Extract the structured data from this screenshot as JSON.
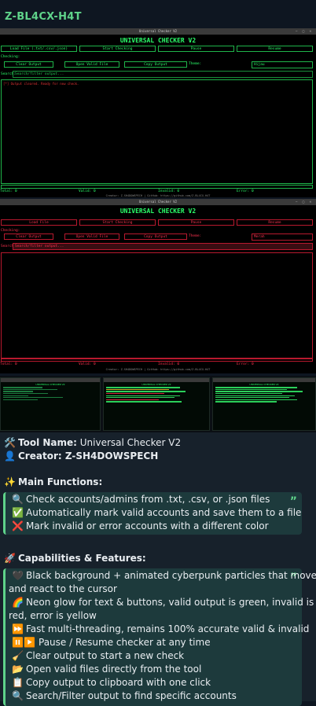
{
  "channel": {
    "title": "Z-BL4CX-H4T"
  },
  "app_green": {
    "window_title": "Universal Checker V2",
    "title": "UNIVERSAL CHECKER V2",
    "buttons": [
      "Load File (.txt/.csv/.json)",
      "Start Checking",
      "Pause",
      "Resume"
    ],
    "checking_label": "Checking:",
    "buttons2": [
      "Clear Output",
      "Open Valid File",
      "Copy Output"
    ],
    "theme_label": "Theme:",
    "theme_value": "Hijau",
    "search_label": "Search:",
    "search_placeholder": "Search/filter output...",
    "output_line": "[*] Output cleared. Ready for new check.",
    "status": [
      "Total: 0",
      "Valid: 0",
      "Invalid: 0",
      "Error: 0"
    ],
    "credit": "Creator: Z-SH4DOWSPECH | GitHub: https://github.com/Z-BL4CX-H4T"
  },
  "app_red": {
    "title": "UNIVERSAL CHECKER V2",
    "buttons": [
      "Load File",
      "Start Checking",
      "Pause",
      "Resume"
    ],
    "checking_label": "Checking:",
    "buttons2": [
      "Clear Output",
      "Open Valid File",
      "Copy Output"
    ],
    "theme_label": "Theme:",
    "theme_value": "Merah",
    "search_label": "Search:",
    "search_placeholder": "Search/filter output...",
    "status": [
      "Total: 0",
      "Valid: 0",
      "Invalid: 0",
      "Error: 0"
    ],
    "credit": "Creator: Z-SH4DOWSPECH | GitHub: https://github.com/Z-BL4CX-H4T"
  },
  "thumbs": {
    "titles": [
      "UNIVERSAL CHECKER V2",
      "UNIVERSAL CHECKER V2",
      "UNIVERSAL CHECKER V2"
    ]
  },
  "post": {
    "tool_label": "Tool Name:",
    "tool_value": " Universal Checker V2",
    "creator_label": "Creator:",
    "creator_value": " Z-SH4DOWSPECH",
    "main_heading": "Main Functions:",
    "main_items": [
      {
        "icon": "🔍",
        "text": "Check accounts/admins from .txt, .csv, or .json files"
      },
      {
        "icon": "✅",
        "text": "Automatically mark valid accounts and save them to a file"
      },
      {
        "icon": "❌",
        "text": "Mark invalid or error accounts with a different color"
      }
    ],
    "cap_heading": "Capabilities & Features:",
    "cap_items": [
      {
        "icon": "🖤",
        "text": "Black background + animated cyberpunk particles that move"
      },
      {
        "icon": "",
        "text": "and react to the cursor"
      },
      {
        "icon": "🌈",
        "text": "Neon glow for text & buttons, valid output is green, invalid is"
      },
      {
        "icon": "",
        "text": "red, error is yellow"
      },
      {
        "icon": "⏩",
        "text": "Fast multi-threading, remains 100% accurate valid & invalid"
      },
      {
        "icon": "⏸️▶️",
        "text": "Pause / Resume checker at any time"
      },
      {
        "icon": "🧹",
        "text": "Clear output to start a new check"
      },
      {
        "icon": "📂",
        "text": "Open valid files directly from the tool"
      },
      {
        "icon": "📋",
        "text": "Copy output to clipboard with one click"
      },
      {
        "icon": "🔍",
        "text": "Search/Filter output to find specific accounts"
      }
    ],
    "quote_mark": "”"
  },
  "icons": {
    "tool": "hammer-wrench-icon",
    "creator": "person-icon",
    "main": "sparkles-icon",
    "cap": "rocket-icon"
  }
}
